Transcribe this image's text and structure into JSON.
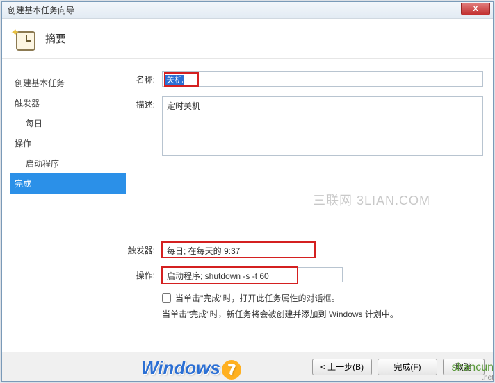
{
  "window": {
    "title": "创建基本任务向导",
    "close": "X"
  },
  "header": {
    "title": "摘要"
  },
  "sidebar": {
    "items": [
      {
        "label": "创建基本任务",
        "sub": false
      },
      {
        "label": "触发器",
        "sub": false
      },
      {
        "label": "每日",
        "sub": true
      },
      {
        "label": "操作",
        "sub": false
      },
      {
        "label": "启动程序",
        "sub": true
      },
      {
        "label": "完成",
        "sub": false,
        "selected": true
      }
    ]
  },
  "form": {
    "name_label": "名称:",
    "name_value": "关机",
    "desc_label": "描述:",
    "desc_value": "定时关机",
    "trigger_label": "触发器:",
    "trigger_value": "每日; 在每天的 9:37",
    "action_label": "操作:",
    "action_value": "启动程序; shutdown -s -t 60",
    "checkbox_label": "当单击\"完成\"时，打开此任务属性的对话框。",
    "note": "当单击\"完成\"时，新任务将会被创建并添加到 Windows 计划中。"
  },
  "watermark": "三联网 3LIAN.COM",
  "footer": {
    "back": "< 上一步(B)",
    "finish": "完成(F)",
    "cancel": "取消"
  },
  "logo": {
    "text": "Windows",
    "seven": "7"
  },
  "shancun": {
    "main": "shancun",
    "sub": ".net"
  }
}
